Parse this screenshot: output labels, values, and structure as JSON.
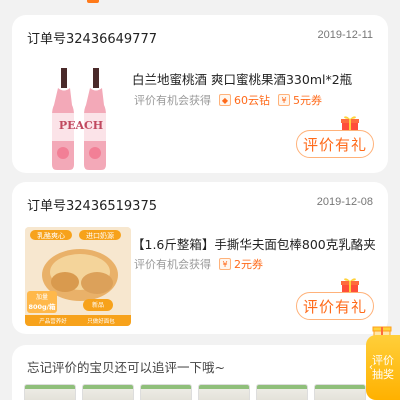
{
  "orders": [
    {
      "order_no": "订单号32436649777",
      "date": "2019-12-11",
      "title": "白兰地蜜桃酒 爽口蜜桃果酒330ml*2瓶",
      "reward_label": "评价有机会获得",
      "rewards": [
        {
          "icon": "diamond-icon",
          "text": "60云钻"
        },
        {
          "icon": "coupon-icon",
          "text": "5元券"
        }
      ],
      "button": "评价有礼",
      "image_text": "PEACH"
    },
    {
      "order_no": "订单号32436519375",
      "date": "2019-12-08",
      "title": "【1.6斤整箱】手撕华夫面包棒800克乳酪夹",
      "reward_label": "评价有机会获得",
      "rewards": [
        {
          "icon": "coupon-icon",
          "text": "2元券"
        }
      ],
      "button": "评价有礼",
      "image_text": {
        "banner1": "乳酪爽心",
        "banner2": "进口奶源",
        "weight1": "加量",
        "weight2": "800g/箱",
        "footer1": "产品营养好",
        "footer2": "只做好面包",
        "tag": "新品"
      }
    }
  ],
  "followup": {
    "title": "忘记评价的宝贝还可以追评一下哦~",
    "thumbs": 7
  },
  "side_tab": {
    "line1": "评价",
    "line2": "抽奖"
  },
  "colors": {
    "accent": "#ff6a1a",
    "side_tab": "#ffbf1f"
  }
}
